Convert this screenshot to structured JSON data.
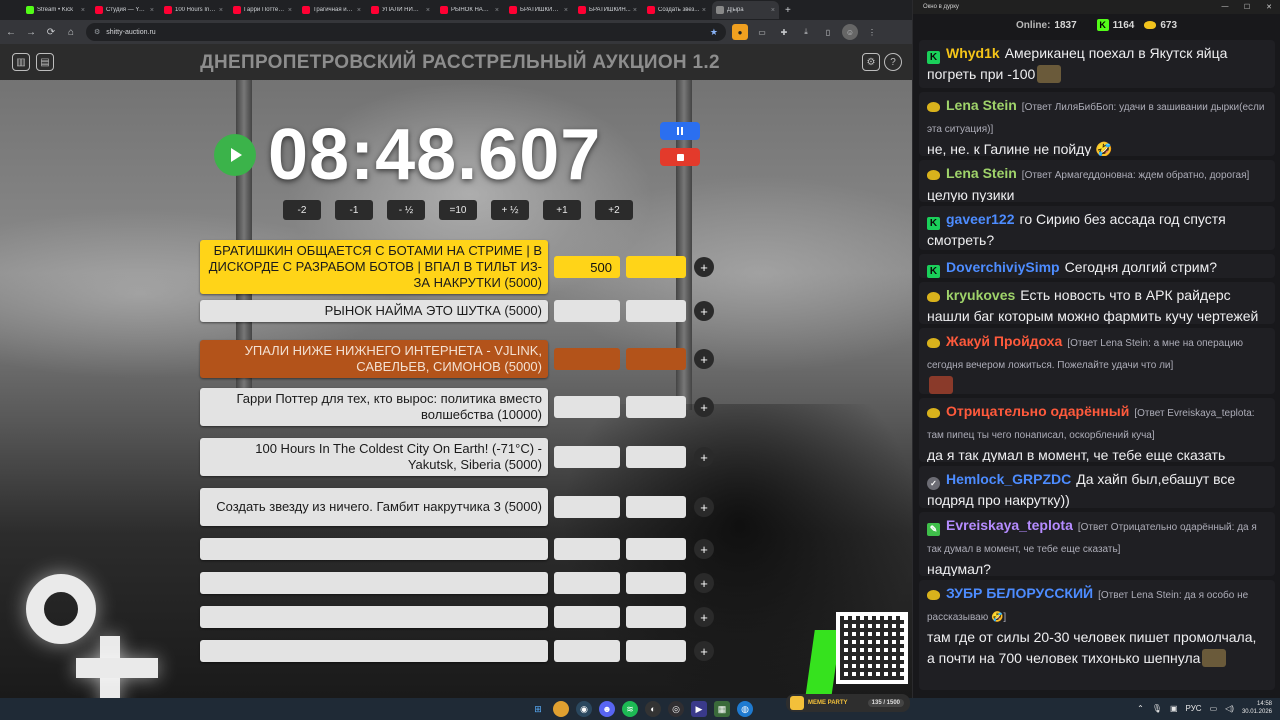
{
  "browser": {
    "tabs": [
      {
        "title": "Stream • Kick",
        "color": "#53fc18"
      },
      {
        "title": "Студия — YouTube",
        "color": "#ff0033"
      },
      {
        "title": "100 Hours In The Coldest...",
        "color": "#ff0033"
      },
      {
        "title": "Гарри Поттер для тех...",
        "color": "#ff0033"
      },
      {
        "title": "Трагичная история...",
        "color": "#ff0033"
      },
      {
        "title": "УПАЛИ НИЖЕ НИЖНЕГО...",
        "color": "#ff0033"
      },
      {
        "title": "РЫНОК НАЙМА...",
        "color": "#ff0033"
      },
      {
        "title": "БРАТИШКИН ОБЩ...",
        "color": "#ff0033"
      },
      {
        "title": "БРАТИШКИН...",
        "color": "#ff0033"
      },
      {
        "title": "Создать звез...",
        "color": "#ff0033"
      },
      {
        "title": "Д|ыра",
        "color": "#888888"
      }
    ],
    "url": "shitty-auction.ru"
  },
  "auction": {
    "title": "ДНЕПРОПЕТРОВСКИЙ РАССТРЕЛЬНЫЙ АУКЦИОН 1.2",
    "timer": "08:48.607",
    "time_adjust": [
      "-2",
      "-1",
      "- ½",
      "=10",
      "+ ½",
      "+1",
      "+2"
    ],
    "add_label": "+",
    "lots": [
      {
        "name": "БРАТИШКИН ОБЩАЕТСЯ С БОТАМИ НА СТРИМЕ | В ДИСКОРДЕ С РАЗРАБОМ БОТОВ | ВПАЛ В ТИЛЬТ ИЗ-ЗА НАКРУТКИ (5000)",
        "amount": "500",
        "style": "gold"
      },
      {
        "name": "РЫНОК НАЙМА ЭТО ШУТКА (5000)",
        "amount": "",
        "style": "plain"
      },
      {
        "name": "УПАЛИ НИЖЕ НИЖНЕГО ИНТЕРНЕТА - VJLINK, САВЕЛЬЕВ, СИМОНОВ (5000)",
        "amount": "",
        "style": "rust"
      },
      {
        "name": "Гарри Поттер для тех, кто вырос: политика вместо волшебства (10000)",
        "amount": "",
        "style": "plain"
      },
      {
        "name": "100 Hours In The Coldest City On Earth! (-71°C) - Yakutsk, Siberia (5000)",
        "amount": "",
        "style": "plain"
      },
      {
        "name": "Создать звезду из ничего. Гамбит накрутчика 3 (5000)",
        "amount": "",
        "style": "plain"
      },
      {
        "name": "",
        "amount": "",
        "style": "plain"
      },
      {
        "name": "",
        "amount": "",
        "style": "plain"
      },
      {
        "name": "",
        "amount": "",
        "style": "plain"
      },
      {
        "name": "",
        "amount": "",
        "style": "plain"
      }
    ]
  },
  "chat": {
    "window_title": "Окно в дурку",
    "online_label": "Online:",
    "online": "1837",
    "kick_count": "1164",
    "coin_count": "673",
    "messages": [
      {
        "badge": "kick",
        "user": "Whyd1k",
        "color": "#f5c518",
        "reply": "",
        "text": "Американец поехал в Якутск яйца погреть при -100",
        "emote": true
      },
      {
        "badge": "coin",
        "user": "Lena Stein",
        "color": "#9fd36a",
        "reply": "[Ответ ЛиляБибБоп: удачи в зашивании дырки(если эта ситуация)]",
        "text": "не, не. к Галине не пойду 🤣",
        "emote": false
      },
      {
        "badge": "coin",
        "user": "Lena Stein",
        "color": "#9fd36a",
        "reply": "[Ответ Армагеддоновна: ждем обратно, дорогая]",
        "text": "целую пузики",
        "emote": false
      },
      {
        "badge": "kick",
        "user": "gaveer122",
        "color": "#4d8cff",
        "reply": "",
        "text": "го Сирию без ассада год спустя смотреть?",
        "emote": false
      },
      {
        "badge": "kick",
        "user": "DoverchiviySimp",
        "color": "#4d8cff",
        "reply": "",
        "text": "Сегодня долгий стрим?",
        "emote": false
      },
      {
        "badge": "coin",
        "user": "kryukoves",
        "color": "#9fd36a",
        "reply": "",
        "text": "Есть новость что в АРК райдерс нашли баг которым можно фармить кучу чертежей",
        "emote": false
      },
      {
        "badge": "coin",
        "user": "Жакуй Пройдоха",
        "color": "#ff5a3c",
        "reply": "[Ответ Lena Stein: а мне на операцию сегодня вечером ложиться. Пожелайте удачи что ли]",
        "text": "",
        "emote": true
      },
      {
        "badge": "coin",
        "user": "Отрицательно одарённый",
        "color": "#ff5a3c",
        "reply": "[Ответ Evreiskaya_teplota: там пипец ты чего понаписал, оскорблений куча]",
        "text": "да я так думал в момент, че тебе еще сказать",
        "emote": false
      },
      {
        "badge": "check",
        "user": "Hemlock_GRPZDC",
        "color": "#4d8cff",
        "reply": "",
        "text": "Да хайп был,ебашут все подряд про накрутку))",
        "emote": false
      },
      {
        "badge": "pen",
        "user": "Evreiskaya_teplota",
        "color": "#b58cff",
        "reply": "[Ответ Отрицательно одарённый: да я так думал в момент, че тебе еще сказать]",
        "text": "надумал?",
        "emote": false
      },
      {
        "badge": "coin",
        "user": "ЗУБР БЕЛОРУССКИЙ",
        "color": "#4d8cff",
        "reply": "[Ответ Lena Stein: да я особо не рассказываю 🤣]",
        "text": "там где от силы 20-30 человек пишет промолчала, а почти на 700 человек тихонько шепнула",
        "emote": true
      }
    ]
  },
  "overlay": {
    "meme_party": "MEME PARTY",
    "meme_count": "135 / 1500"
  },
  "taskbar": {
    "lang": "РУС",
    "time": "14:58",
    "date": "30.01.2026"
  }
}
